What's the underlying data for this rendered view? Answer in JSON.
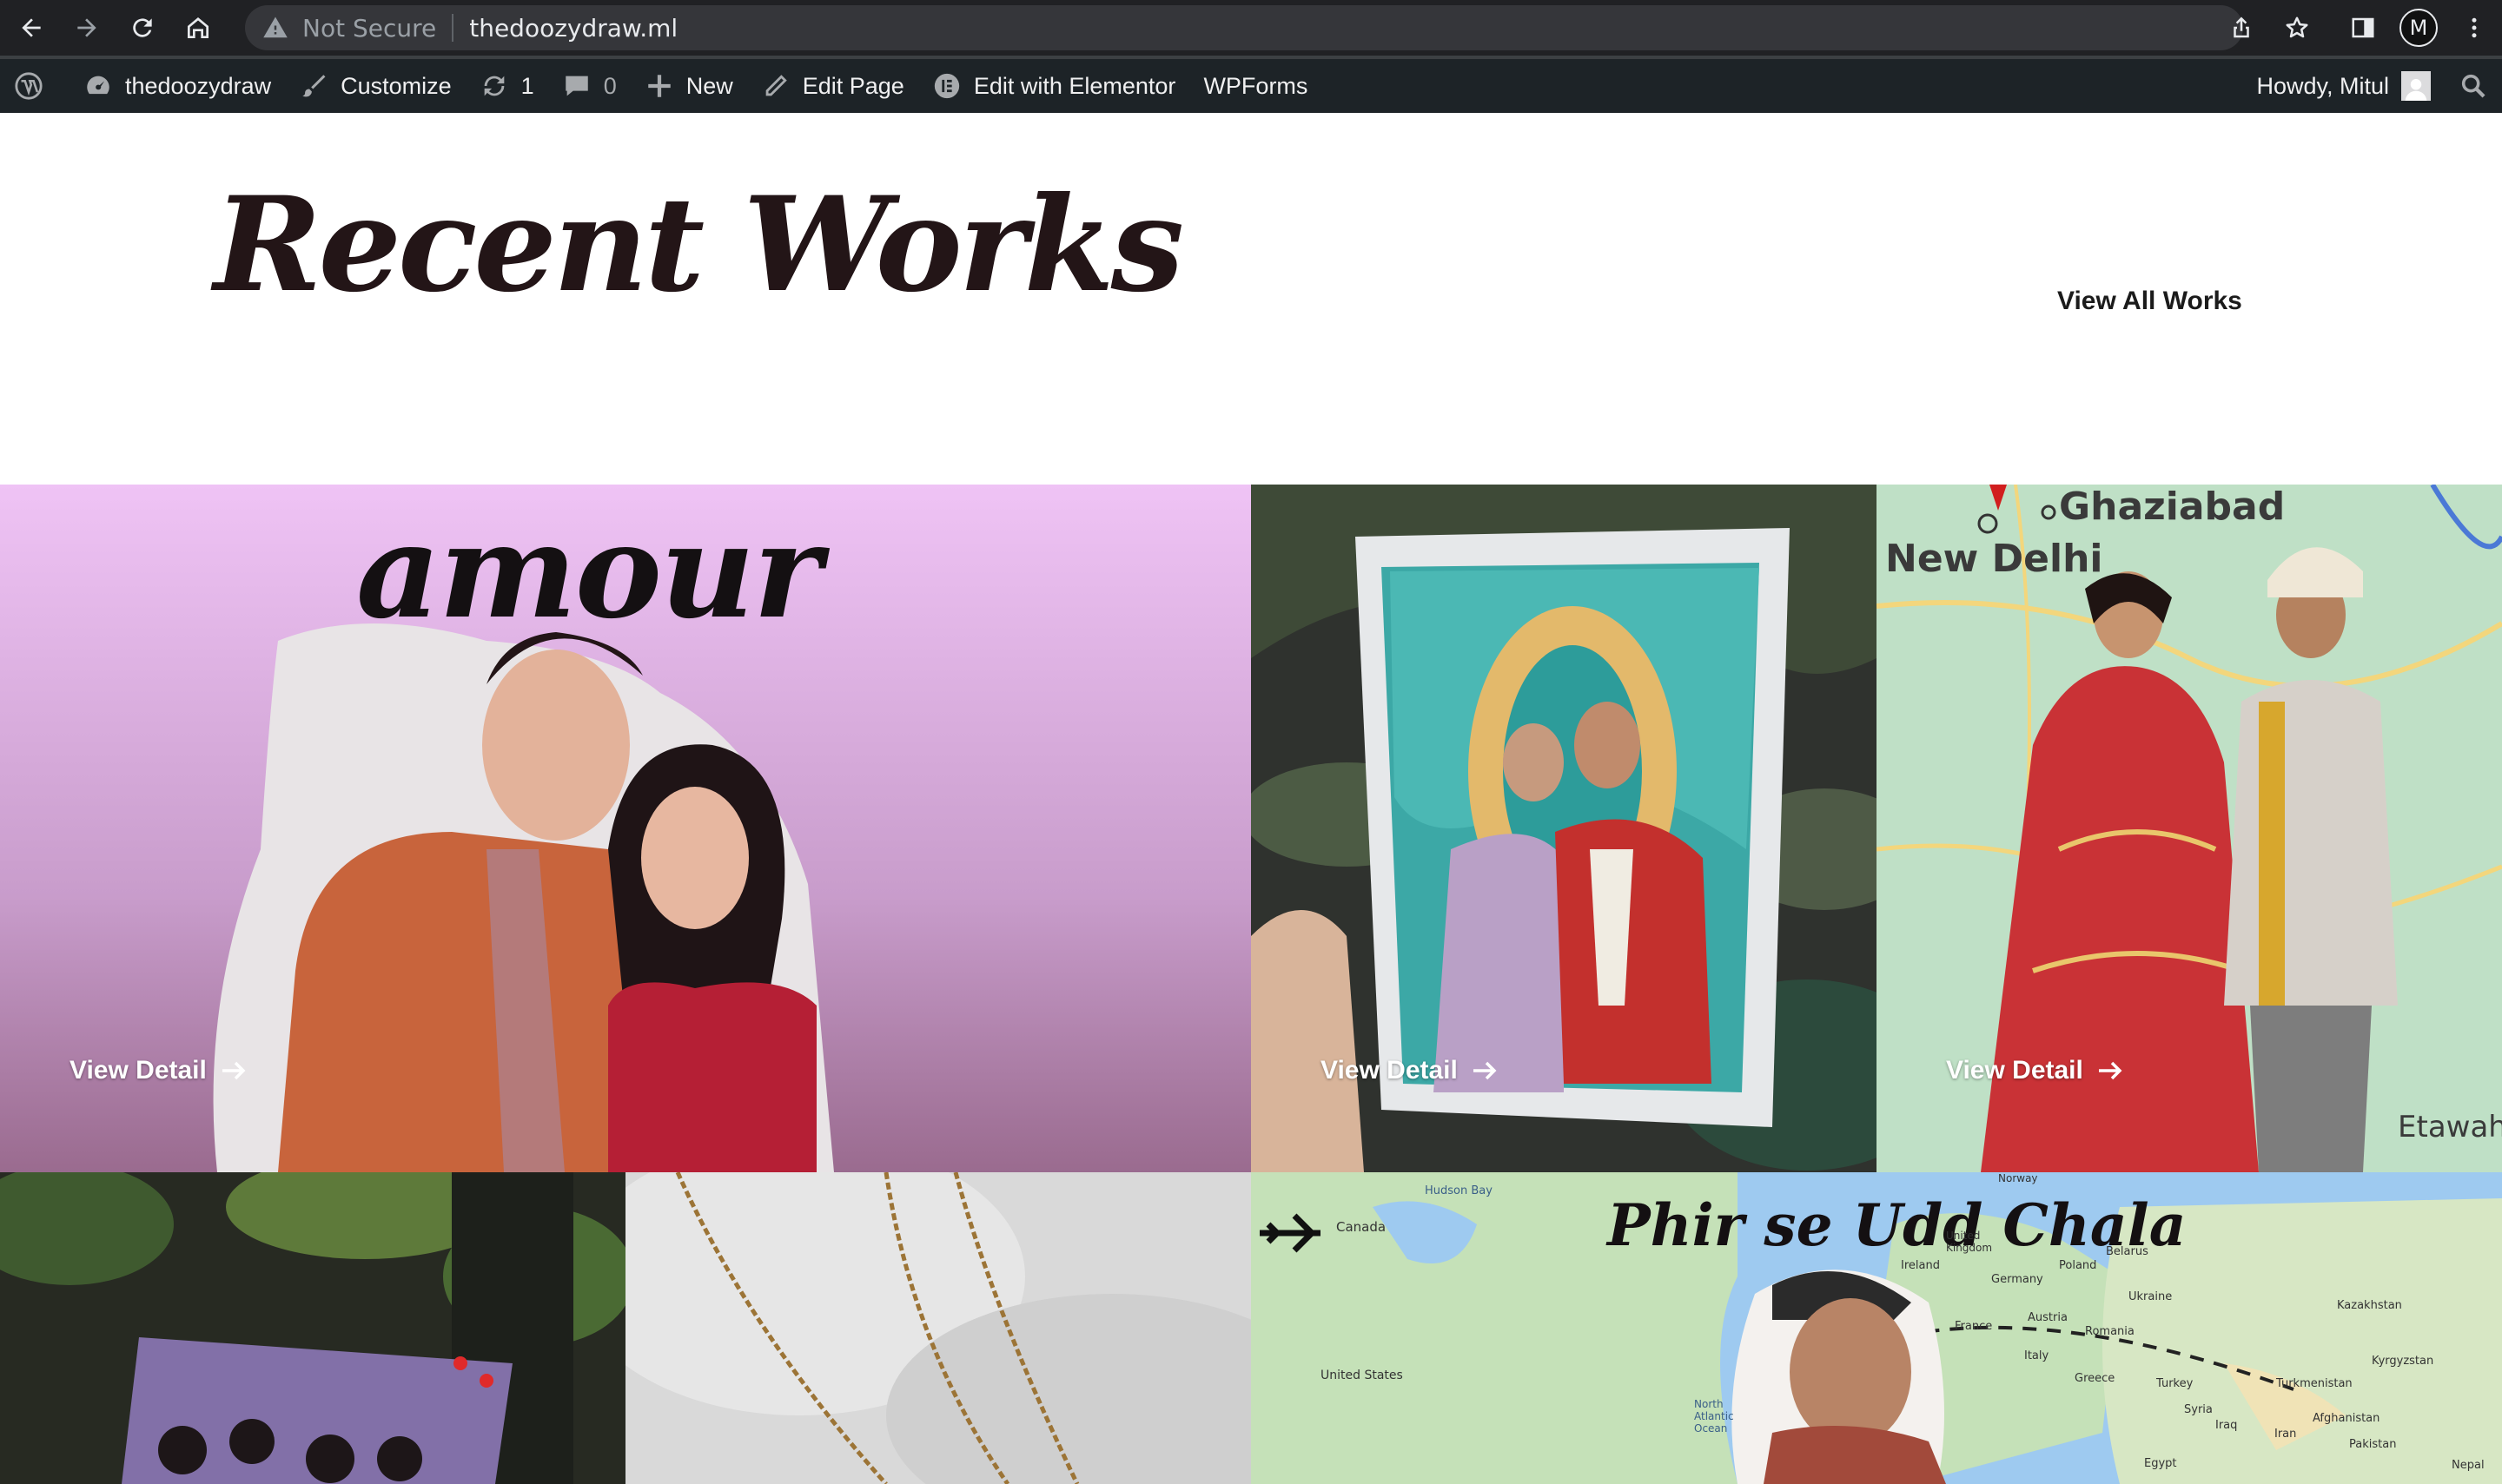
{
  "browser": {
    "security_label": "Not Secure",
    "url": "thedoozydraw.ml",
    "profile_initial": "M"
  },
  "adminbar": {
    "site_name": "thedoozydraw",
    "customize": "Customize",
    "updates_count": "1",
    "comments_count": "0",
    "new": "New",
    "edit_page": "Edit Page",
    "edit_elementor": "Edit with Elementor",
    "wpforms": "WPForms",
    "howdy": "Howdy, Mitul"
  },
  "section": {
    "title": "Recent Works",
    "view_all": "View All Works"
  },
  "works": [
    {
      "detail_label": "View Detail",
      "lettering": "amour"
    },
    {
      "detail_label": "View Detail"
    },
    {
      "detail_label": "View Detail",
      "map_labels": [
        "Ghaziabad",
        "New Delhi",
        "Etawah"
      ]
    },
    {
      "lettering": "Phir se Udd Chala",
      "map_labels": [
        "Canada",
        "Hudson Bay",
        "United States",
        "North Atlantic Ocean",
        "Ireland",
        "United Kingdom",
        "Germany",
        "Poland",
        "Belarus",
        "Ukraine",
        "France",
        "Austria",
        "Romania",
        "Italy",
        "Greece",
        "Turkey",
        "Syria",
        "Iraq",
        "Iran",
        "Egypt",
        "Kazakhstan",
        "Kyrgyzstan",
        "Turkmenistan",
        "Afghanistan",
        "Pakistan",
        "Nepal",
        "Norway"
      ]
    }
  ],
  "colors": {
    "admin_bar": "#1d2327",
    "chrome": "#202124",
    "title": "#231517"
  }
}
